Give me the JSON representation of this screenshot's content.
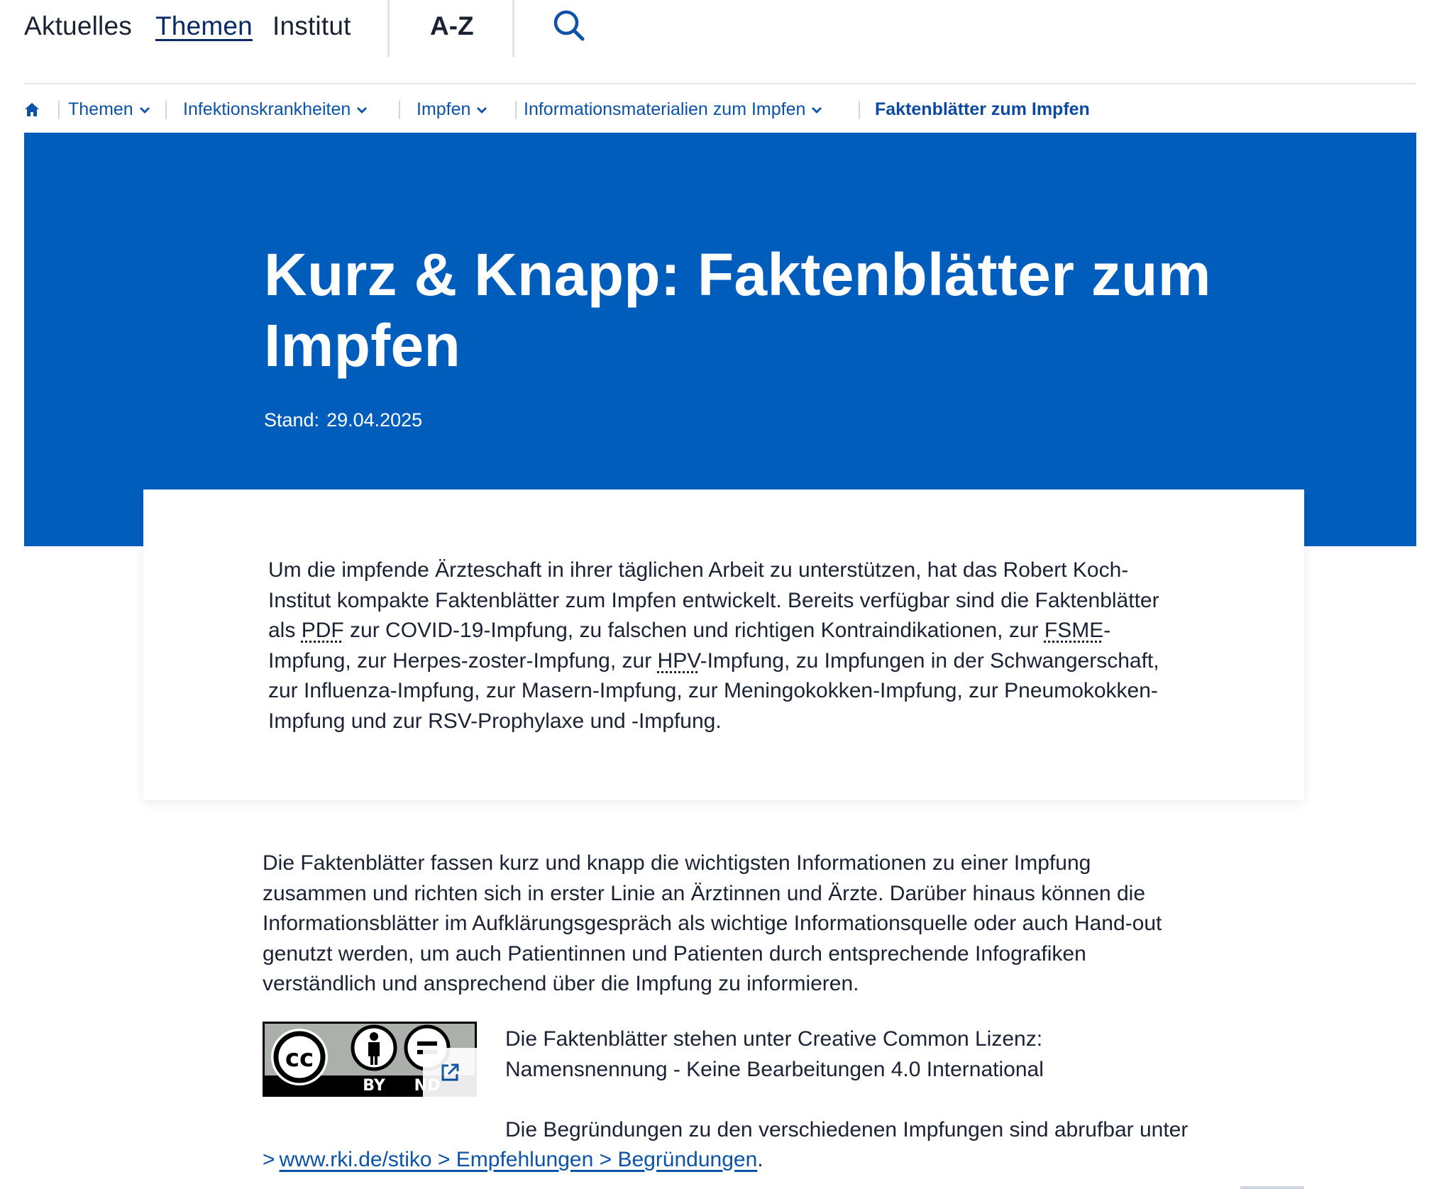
{
  "topnav": {
    "items": [
      {
        "label": "Aktuelles"
      },
      {
        "label": "Themen",
        "active": true
      },
      {
        "label": "Institut"
      }
    ],
    "az_label": "A-Z",
    "search_icon": "search-icon"
  },
  "breadcrumb": {
    "home_icon": "home-icon",
    "items": [
      {
        "label": "Themen",
        "has_dropdown": true
      },
      {
        "label": "Infektionskrankheiten",
        "has_dropdown": true
      },
      {
        "label": "Impfen",
        "has_dropdown": true
      },
      {
        "label": "Informationsmaterialien zum Impfen",
        "has_dropdown": true
      },
      {
        "label": "Faktenblätter zum Impfen",
        "current": true
      }
    ]
  },
  "hero": {
    "title": "Kurz & Knapp: Faktenblätter zum Impfen",
    "stand_label": "Stand:",
    "stand_date": "29.04.2025",
    "background": "#005dbc"
  },
  "intro": {
    "part1": "Um die impfende Ärzteschaft in ihrer täglichen Arbeit zu unterstützen, hat das Robert Koch-Institut kompakte Faktenblätter zum Impfen entwickelt. Bereits verfügbar sind die Faktenblätter als ",
    "abbr_pdf": "PDF",
    "part2": " zur COVID-19-Impfung, zu falschen und richtigen Kontraindikationen, zur ",
    "abbr_fsme": "FSME",
    "part3": "-Impfung, zur Herpes-zoster-Impfung, zur ",
    "abbr_hpv": "HPV",
    "part4": "-Impfung, zu Impfungen in der Schwangerschaft, zur Influenza-Impfung, zur Masern-Impfung, zur Meningokokken-Impfung, zur Pneumokokken-Impfung und zur RSV-Prophylaxe und -Impfung."
  },
  "body": {
    "paragraph1": "Die Faktenblätter fassen kurz und knapp die wichtigsten Informationen zu einer Impfung zusammen und richten sich in erster Linie an Ärztinnen und Ärzte. Darüber hinaus können die Informationsblätter im Aufklärungsgespräch als wichtige Informationsquelle oder auch Hand-out genutzt werden, um auch Patientinnen und Patienten durch entsprechende Infografiken verständlich und ansprechend über die Impfung zu informieren.",
    "license_line1": "Die Faktenblätter stehen unter Creative Common Lizenz:",
    "license_line2": "Namensnennung - Keine Bearbeitungen 4.0 International",
    "cc_badge": {
      "cc": "cc",
      "by": "BY",
      "nd": "ND",
      "icon": "cc-by-nd-badge-icon",
      "external_icon": "external-link-icon"
    },
    "begr_text": "Die Begründungen zu den verschiedenen Impfungen sind abrufbar unter",
    "begr_arrow": ">",
    "begr_link": "www.rki.de/stiko > Empfehlungen > Begründungen",
    "begr_period": "."
  }
}
